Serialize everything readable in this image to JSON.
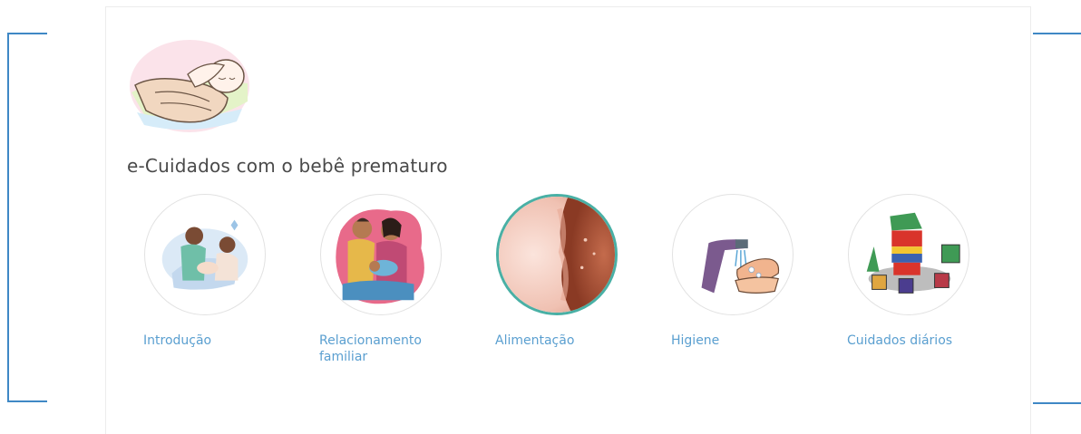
{
  "header": {
    "title": "e-Cuidados com o bebê prematuro",
    "logo_icon": "premature-baby-in-hands-icon"
  },
  "topics": [
    {
      "label": "Introdução",
      "icon": "nurse-with-mother-icon",
      "active": false
    },
    {
      "label": "Relacionamento familiar",
      "icon": "family-with-baby-icon",
      "active": false
    },
    {
      "label": "Alimentação",
      "icon": "feeding-closeup-icon",
      "active": true
    },
    {
      "label": "Higiene",
      "icon": "hand-washing-icon",
      "active": false
    },
    {
      "label": "Cuidados diários",
      "icon": "toy-blocks-icon",
      "active": false
    }
  ],
  "colors": {
    "bracket": "#3f88c5",
    "link": "#5a9fd0",
    "active_ring": "#49b0a5",
    "title_text": "#4a4a4a"
  }
}
